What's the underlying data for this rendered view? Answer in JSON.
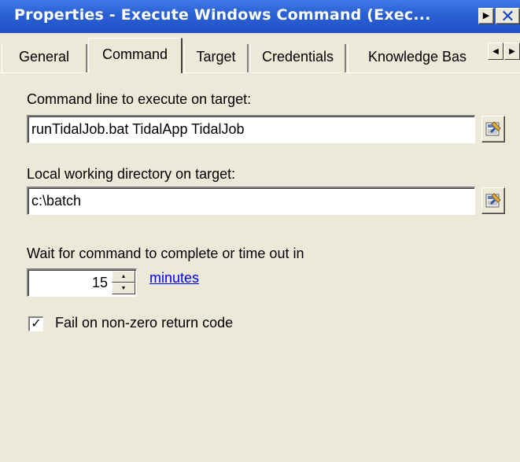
{
  "window": {
    "title": "Properties - Execute Windows Command (Exec..."
  },
  "tabs": [
    {
      "label": "General",
      "active": false
    },
    {
      "label": "Command",
      "active": true
    },
    {
      "label": "Target",
      "active": false
    },
    {
      "label": "Credentials",
      "active": false
    },
    {
      "label": "Knowledge Bas",
      "active": false
    }
  ],
  "command": {
    "command_line_label": "Command line to execute on target:",
    "command_line_value": "runTidalJob.bat TidalApp TidalJob",
    "working_dir_label": "Local working directory on target:",
    "working_dir_value": "c:\\batch",
    "wait_label": "Wait for command to complete or time out in",
    "timeout_value": "15",
    "timeout_unit_link": "minutes",
    "fail_nonzero_label": "Fail on non-zero return code",
    "fail_nonzero_checked": true
  },
  "icons": {
    "expand": "triangle-right-icon",
    "close": "close-icon",
    "browse": "browse-picker-icon"
  },
  "colors": {
    "titlebar": "#2a5fd2",
    "face": "#ece9d8",
    "link": "#0000ff"
  }
}
